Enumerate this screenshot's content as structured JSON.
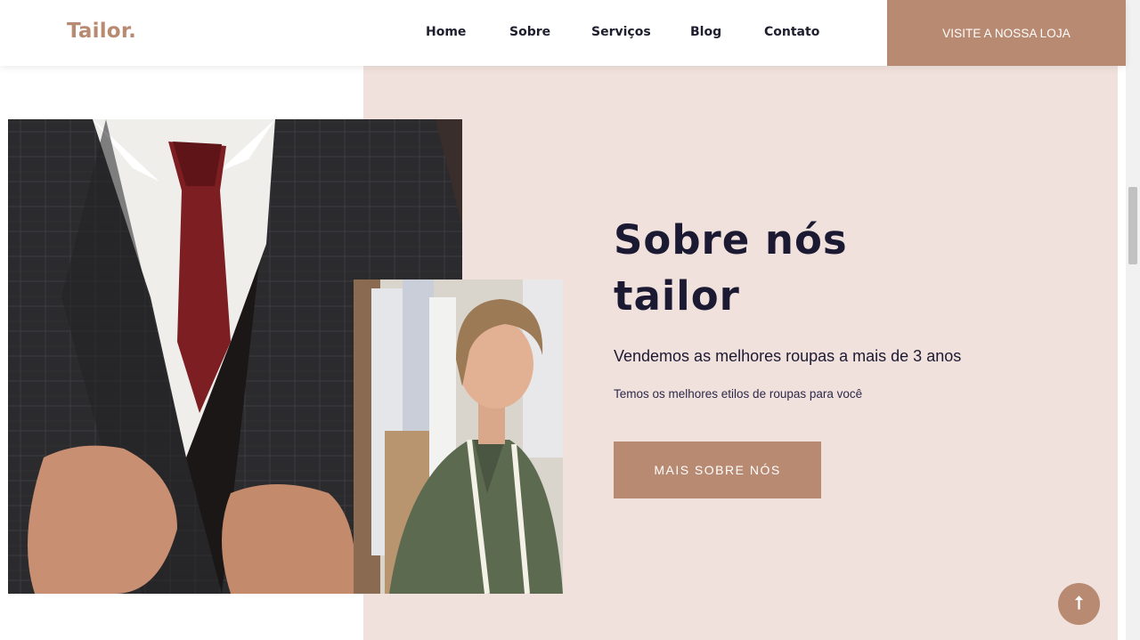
{
  "header": {
    "logo": "Tailor.",
    "nav": [
      {
        "label": "Home"
      },
      {
        "label": "Sobre"
      },
      {
        "label": "Serviços"
      },
      {
        "label": "Blog"
      },
      {
        "label": "Contato"
      }
    ],
    "store_button": "VISITE A NOSSA LOJA"
  },
  "about": {
    "title_line1": "Sobre nós",
    "title_line2": "tailor",
    "subtitle": "Vendemos as melhores roupas a mais de 3 anos",
    "description": "Temos os melhores etilos de roupas para você",
    "button": "MAIS SOBRE NÓS"
  },
  "icons": {
    "to_top": "arrow-up-icon"
  },
  "colors": {
    "accent": "#b88a72",
    "section_bg": "#f1e1dc",
    "heading": "#1c1a33"
  }
}
